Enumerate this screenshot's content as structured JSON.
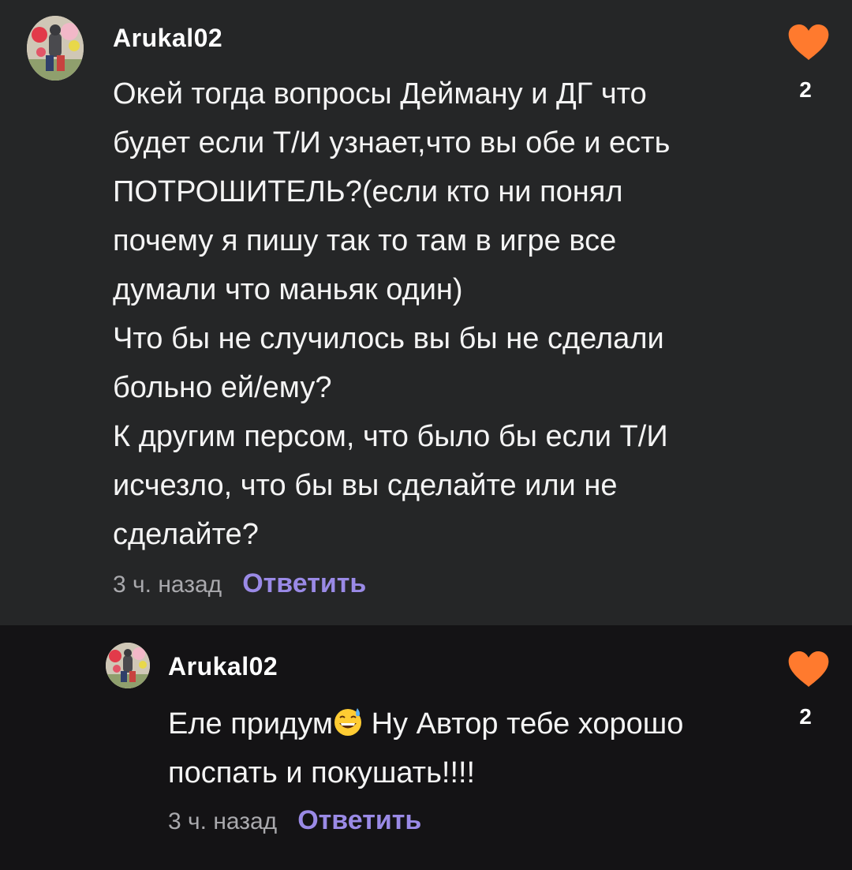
{
  "comments": [
    {
      "username": "Arukal02",
      "text": "Окей тогда вопросы Дейману и ДГ что\nбудет если Т/И узнает,что вы обе и есть\nПОТРОШИТЕЛЬ?(если кто ни понял\nпочему я пишу так то там в игре все\nдумали что маньяк один)\nЧто бы не случилось вы бы не сделали\nбольно ей/ему?\nК другим персом, что было бы если Т/И\nисчезло, что бы вы сделайте или не\nсделайте?",
      "time": "3 ч. назад",
      "reply_label": "Ответить",
      "likes": "2"
    },
    {
      "username": "Arukal02",
      "text_before_emoji": "Еле придум",
      "emoji": "grinning-sweat-emoji",
      "text_after_emoji": " Ну Автор тебе хорошо\nпоспать и покушать!!!!",
      "time": "3 ч. назад",
      "reply_label": "Ответить",
      "likes": "2"
    }
  ],
  "colors": {
    "main_bg": "#252627",
    "reply_bg": "#141315",
    "heart": "#ff7a2e",
    "reply_link": "#9a8ae6",
    "time": "#a9a9ad"
  }
}
